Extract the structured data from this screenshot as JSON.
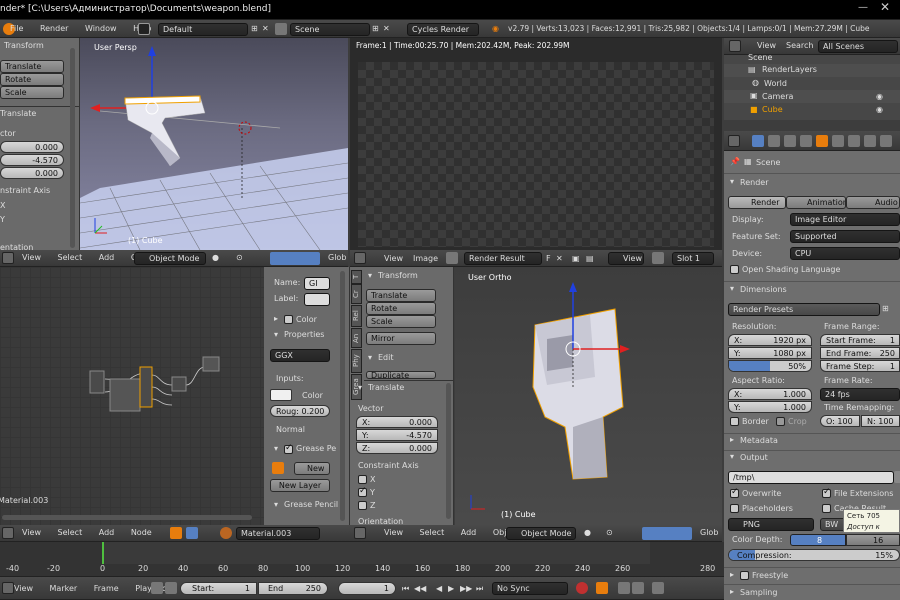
{
  "titlebar": {
    "title": "nder* [C:\\Users\\Администратор\\Documents\\weapon.blend]"
  },
  "topbar": {
    "menus": [
      "File",
      "Render",
      "Window",
      "Help"
    ],
    "screen": "Default",
    "scene": "Scene",
    "engine": "Cycles Render",
    "stats": "v2.79 | Verts:13,023 | Faces:12,991 | Tris:25,982 | Objects:1/4 | Lamps:0/1 | Mem:27.29M | Cube"
  },
  "tool_left": {
    "transform_hdr": "Transform",
    "buttons": [
      "Translate",
      "Rotate",
      "Scale"
    ],
    "translate_hdr": "Translate",
    "vector_lbl": "ctor",
    "vals": [
      "0.000",
      "-4.570",
      "0.000"
    ],
    "constraint_lbl": "nstraint Axis",
    "axes": [
      "X",
      "Y"
    ],
    "orient_lbl": "entation"
  },
  "viewport_tl": {
    "label": "User Persp",
    "obj": "(1) Cube"
  },
  "render_view": {
    "info": "Frame:1 | Time:00:25.70 | Mem:202.42M, Peak: 202.99M"
  },
  "viewport_br": {
    "label": "User Ortho",
    "obj": "(1) Cube"
  },
  "hdr3d": {
    "menus": [
      "View",
      "Select",
      "Add",
      "Object"
    ],
    "mode": "Object Mode",
    "glob": "Glob"
  },
  "imgedit_hdr": {
    "menus": [
      "View",
      "Image"
    ],
    "image": "Render Result",
    "f": "F",
    "view": "View",
    "slot": "Slot 1"
  },
  "node_side": {
    "name_lbl": "Name:",
    "name_val": "GI",
    "label_lbl": "Label:",
    "color": "Color",
    "properties": "Properties",
    "dist": "GGX",
    "inputs": "Inputs:",
    "color2": "Color",
    "rough": "Roug: 0.200",
    "normal": "Normal",
    "grease": "Grease Pe",
    "new_btn": "New",
    "new_layer": "New Layer",
    "grease2": "Grease Pencil"
  },
  "node_hdr": {
    "menus": [
      "View",
      "Select",
      "Add",
      "Node"
    ],
    "material": "Material.003"
  },
  "node_material": "Material.003",
  "br_tool": {
    "tabs": [
      "T",
      "Cr",
      "Rel",
      "An",
      "Phy",
      "Grea"
    ],
    "transform": "Transform",
    "buttons": [
      "Translate",
      "Rotate",
      "Scale"
    ],
    "mirror": "Mirror",
    "edit": "Edit",
    "dup": "Duplicate",
    "translate": "Translate",
    "vector": "Vector",
    "vals": [
      {
        "l": "X:",
        "v": "0.000"
      },
      {
        "l": "Y:",
        "v": "-4.570"
      },
      {
        "l": "Z:",
        "v": "0.000"
      }
    ],
    "constraint": "Constraint Axis",
    "axes": [
      "X",
      "Y",
      "Z"
    ],
    "orient": "Orientation"
  },
  "outliner": {
    "menus": [
      "View",
      "Search"
    ],
    "filter": "All Scenes",
    "items": [
      "Scene",
      "RenderLayers",
      "World",
      "Camera",
      "Cube"
    ]
  },
  "props": {
    "scene": "Scene",
    "render_hdr": "Render",
    "tabs": [
      "Render",
      "Animation",
      "Audio"
    ],
    "display_lbl": "Display:",
    "display": "Image Editor",
    "feature_lbl": "Feature Set:",
    "feature": "Supported",
    "device_lbl": "Device:",
    "device": "CPU",
    "osl": "Open Shading Language",
    "dimensions": "Dimensions",
    "presets": "Render Presets",
    "resolution": "Resolution:",
    "resx": "1920 px",
    "resy": "1080 px",
    "pct": "50%",
    "frame_range": "Frame Range:",
    "start": "Start Frame:",
    "start_v": "1",
    "end": "End Frame:",
    "end_v": "250",
    "step": "Frame Step:",
    "step_v": "1",
    "aspect": "Aspect Ratio:",
    "ax": "1.000",
    "ay": "1.000",
    "frame_rate": "Frame Rate:",
    "fps": "24 fps",
    "remap": "Time Remapping:",
    "o": "O: 100",
    "n": "N: 100",
    "border": "Border",
    "crop": "Crop",
    "metadata": "Metadata",
    "output": "Output",
    "path": "/tmp\\",
    "overwrite": "Overwrite",
    "ext": "File Extensions",
    "placeholders": "Placeholders",
    "cache": "Cache Result",
    "format": "PNG",
    "bw": "BW",
    "depth_lbl": "Color Depth:",
    "d8": "8",
    "d16": "16",
    "compression": "Compression:",
    "comp_v": "15%",
    "freestyle": "Freestyle",
    "sampling": "Sampling",
    "x": "X:",
    "y": "Y:"
  },
  "tooltip": {
    "line1": "Сеть 705",
    "line2": "Доступ к Инте"
  },
  "timeline": {
    "ticks": [
      "-40",
      "-20",
      "0",
      "20",
      "40",
      "60",
      "80",
      "100",
      "120",
      "140",
      "160",
      "180",
      "200",
      "220",
      "240",
      "260",
      "280"
    ],
    "menus": [
      "View",
      "Marker",
      "Frame",
      "Playback"
    ],
    "start": "Start:",
    "start_v": "1",
    "end": "End",
    "end_v": "250",
    "cur": "1",
    "sync": "No Sync"
  },
  "colors": {
    "accent": "#5680c2",
    "selected": "#f0a000"
  }
}
